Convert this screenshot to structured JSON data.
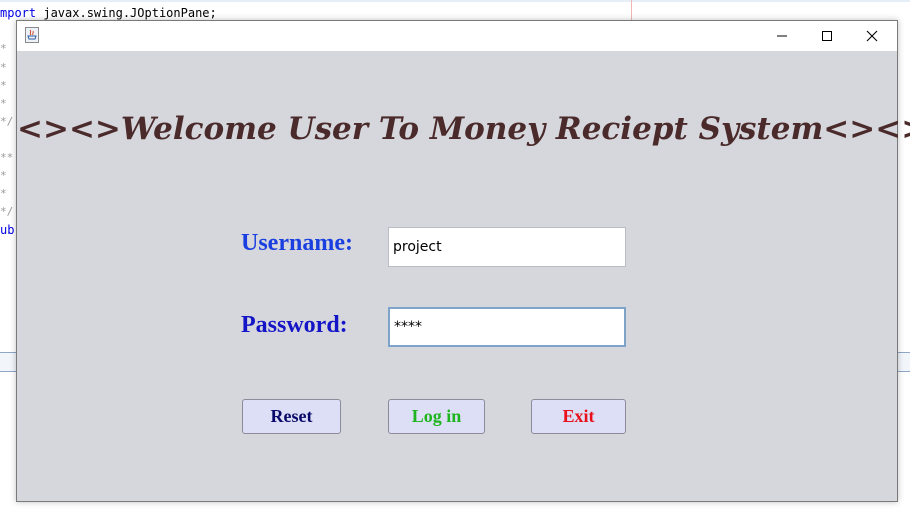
{
  "editor": {
    "line1_keyword": "mport",
    "line1_text": " javax.swing.JOptionPane;",
    "side_marks": [
      "*",
      "*",
      "*",
      "*",
      "*/",
      "**",
      "*",
      "*",
      "*/"
    ],
    "side_keyword": "ub"
  },
  "window": {
    "heading": "<><>Welcome User To Money Reciept System<><>",
    "username_label": "Username:",
    "password_label": "Password:",
    "username_value": "project",
    "password_value": "****",
    "buttons": {
      "reset": "Reset",
      "login": "Log in",
      "exit": "Exit"
    }
  },
  "colors": {
    "heading": "#4a2a2a",
    "username_label": "#1a3fe0",
    "password_label": "#1515c8",
    "reset_text": "#0a0a6a",
    "login_text": "#1fb51f",
    "exit_text": "#e8101a",
    "window_bg": "#d6d7dd",
    "button_bg": "#dcdff6"
  }
}
